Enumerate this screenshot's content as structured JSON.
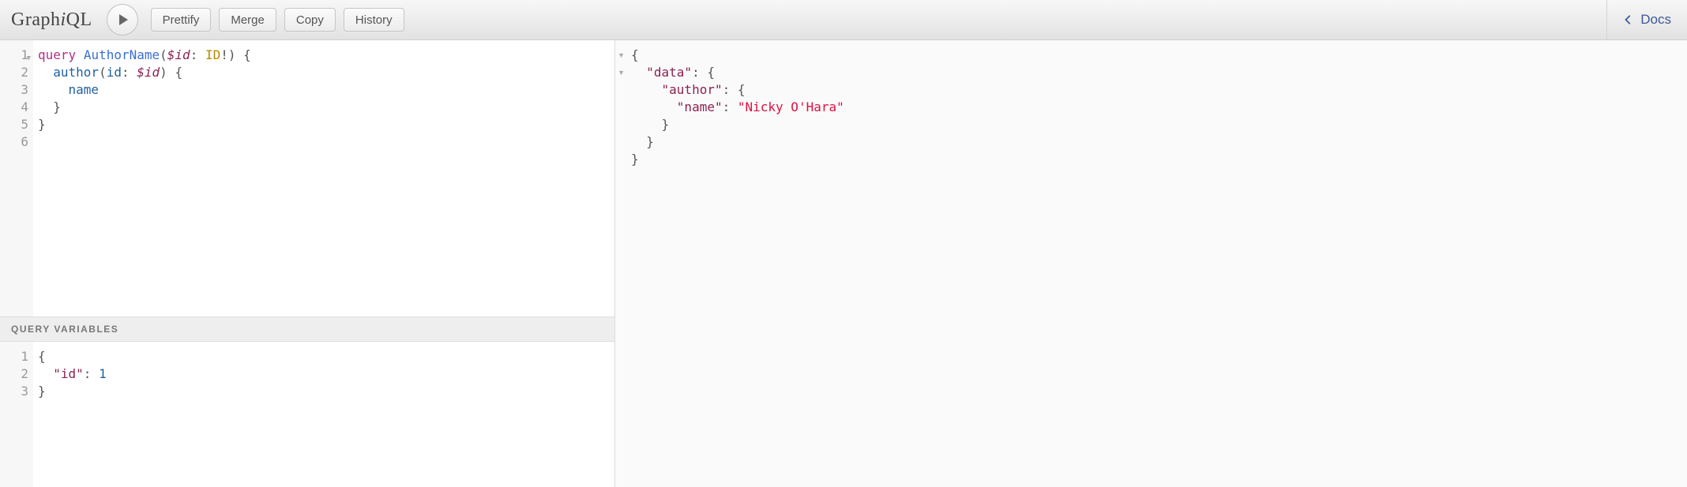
{
  "app": {
    "name": "GraphiQL"
  },
  "toolbar": {
    "prettify": "Prettify",
    "merge": "Merge",
    "copy": "Copy",
    "history": "History",
    "docs": "Docs"
  },
  "query": {
    "gutter": [
      "1",
      "2",
      "3",
      "4",
      "5",
      "6"
    ],
    "tokens": {
      "kw_query": "query",
      "op_name": "AuthorName",
      "lparen": "(",
      "var_id": "$id",
      "colon": ":",
      "type_id": "ID",
      "bang": "!",
      "rparen": ")",
      "lbrace": "{",
      "field_author": "author",
      "arg_id": "id",
      "var_id2": "$id",
      "field_name": "name",
      "rbrace": "}"
    }
  },
  "vars": {
    "header": "Query Variables",
    "gutter": [
      "1",
      "2",
      "3"
    ],
    "tokens": {
      "lbrace": "{",
      "key_id": "\"id\"",
      "colon": ":",
      "val": "1",
      "rbrace": "}"
    }
  },
  "result": {
    "tokens": {
      "lbrace": "{",
      "data": "\"data\"",
      "author": "\"author\"",
      "name": "\"name\"",
      "value": "\"Nicky O'Hara\"",
      "colon": ":",
      "rbrace": "}"
    }
  }
}
